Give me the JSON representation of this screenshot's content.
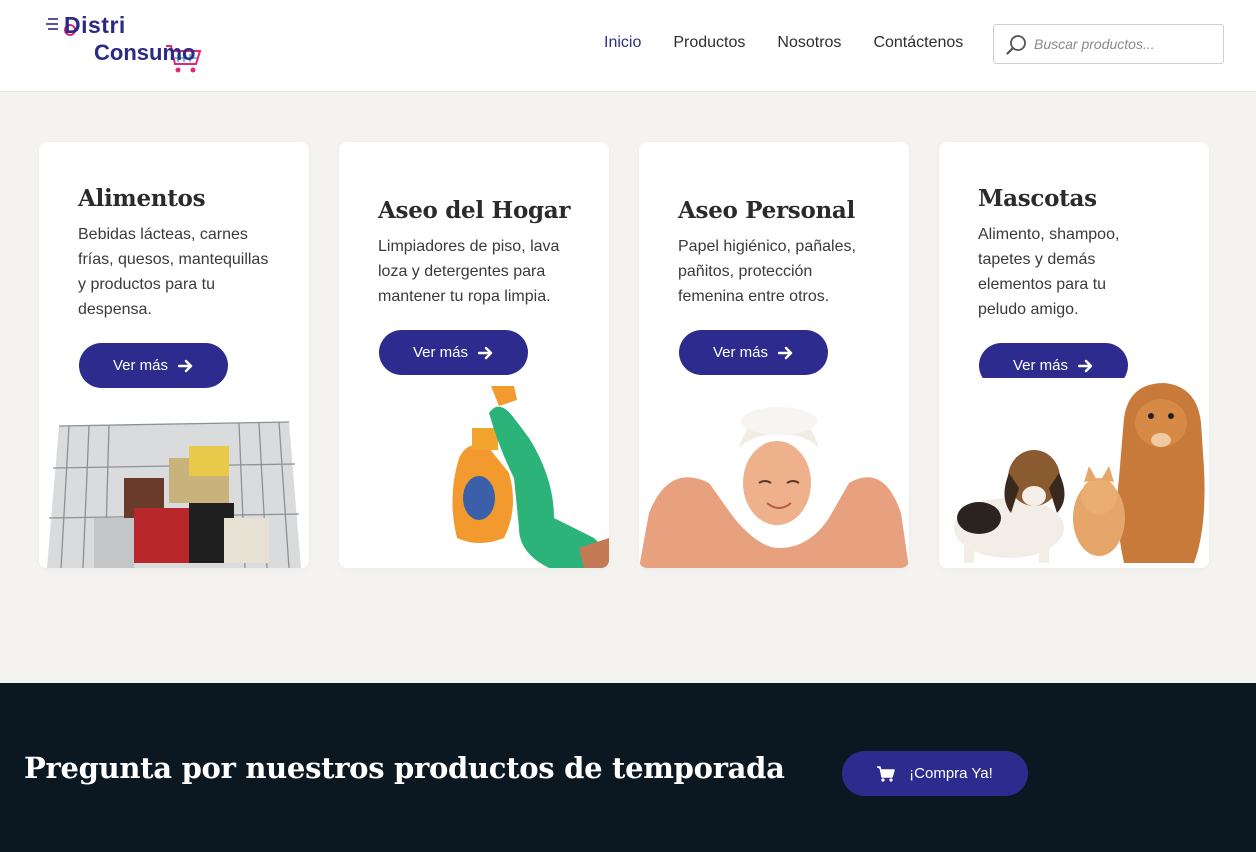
{
  "header": {
    "logo": {
      "line1": "Distri",
      "line2": "Consumo"
    },
    "nav": [
      "Inicio",
      "Productos",
      "Nosotros",
      "Contáctenos"
    ],
    "search_placeholder": "Buscar productos..."
  },
  "cards": [
    {
      "title": "Alimentos",
      "text": "Bebidas lácteas, carnes frías, quesos, mantequillas y productos para tu despensa.",
      "button": "Ver más",
      "image": "shopping-cart-groceries"
    },
    {
      "title": "Aseo del Hogar",
      "text": "Limpiadores de piso, lava loza y detergentes para mantener tu ropa limpia.",
      "button": "Ver más",
      "image": "cleaning-glove-spray"
    },
    {
      "title": "Aseo Personal",
      "text": "Papel higiénico, pañales, pañitos, protección femenina entre otros.",
      "button": "Ver más",
      "image": "woman-shower"
    },
    {
      "title": "Mascotas",
      "text": "Alimento, shampoo, tapetes y demás elementos para tu peludo amigo.",
      "button": "Ver más",
      "image": "puppies-and-kitten"
    }
  ],
  "band": {
    "heading": "Pregunta por nuestros productos de temporada",
    "cta": "¡Compra Ya!"
  },
  "colors": {
    "primary": "#2e2b8f",
    "dark_band": "#0c1821",
    "background": "#f4f3f0"
  }
}
